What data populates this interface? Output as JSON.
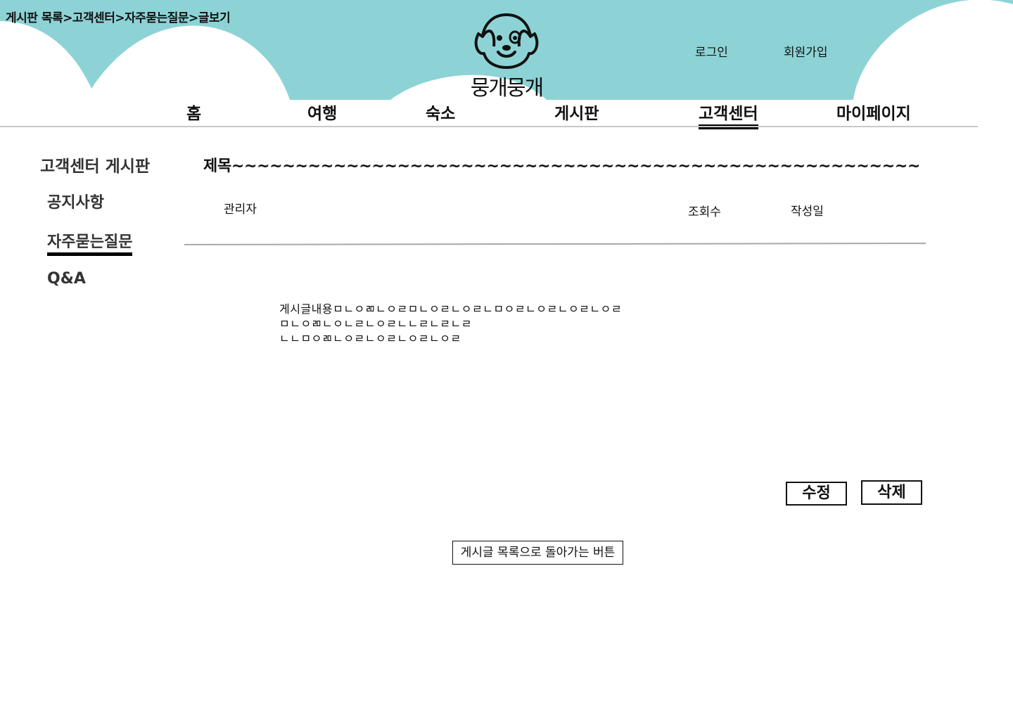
{
  "colors": {
    "header_bg": "#8dd3d6",
    "active_underline": "#000000",
    "divider": "#c8c8c8"
  },
  "breadcrumb": "게시판 목록>고객센터>자주묻는질문>글보기",
  "logo": {
    "icon": "dog-face-icon",
    "text": "뭉개뭉개"
  },
  "auth": {
    "login": "로그인",
    "signup": "회원가입"
  },
  "nav": {
    "items": [
      "홈",
      "여행",
      "숙소",
      "게시판",
      "고객센터",
      "마이페이지"
    ],
    "active": "고객센터"
  },
  "sidebar": {
    "title": "고객센터 게시판",
    "items": [
      "공지사항",
      "자주묻는질문",
      "Q&A"
    ],
    "active": "자주묻는질문"
  },
  "post": {
    "title": "제목~~~~~~~~~~~~~~~~~~~~~~~~~~~~~~~~~~~~~~~~~~~~~~~~~~~~~~",
    "author": "관리자",
    "views_label": "조회수",
    "date_label": "작성일",
    "content_lines": [
      "게시글내용ㅁㄴㅇㄻㄴㅇㄹㅁㄴㅇㄹㄴㅇㄹㄴㅁㅇㄹㄴㅇㄹㄴㅇㄹㄴㅇㄹ",
      "ㅁㄴㅇㄻㄴㅇㄴㄹㄴㅇㄹㄴㄴㄹㄴㄹㄴㄹ",
      "ㄴㄴㅁㅇㄻㄴㅇㄹㄴㅇㄹㄴㅇㄹㄴㅇㄹ"
    ]
  },
  "buttons": {
    "edit": "수정",
    "delete": "삭제",
    "back": "게시글 목록으로 돌아가는 버튼"
  }
}
